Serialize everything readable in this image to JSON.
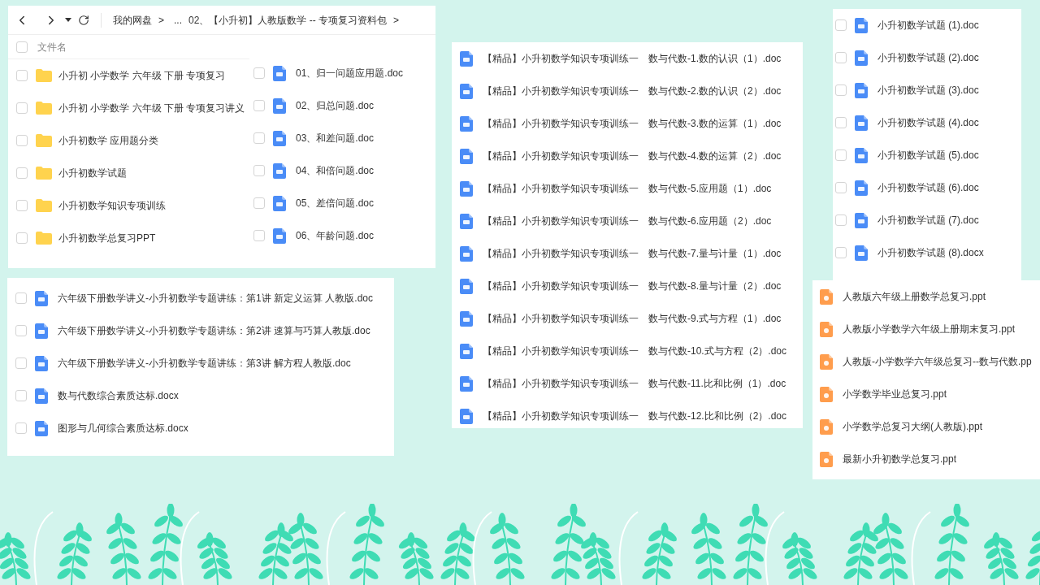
{
  "main_window": {
    "breadcrumb": [
      {
        "kind": "link",
        "text": "我的网盘"
      },
      {
        "kind": "separator",
        "text": ">"
      },
      {
        "kind": "link",
        "text": "..."
      },
      {
        "kind": "link",
        "text": "02、【小升初】人教版数学 -- 专项复习资料包"
      },
      {
        "kind": "separator",
        "text": ">"
      }
    ],
    "header": {
      "label": "文件名",
      "checked": false
    },
    "rows": [
      {
        "kind": "folder",
        "name": "小升初 小学数学 六年级 下册 专项复习",
        "checked": false
      },
      {
        "kind": "folder",
        "name": "小升初 小学数学 六年级 下册 专项复习讲义",
        "checked": false
      },
      {
        "kind": "folder",
        "name": "小升初数学 应用题分类",
        "checked": false
      },
      {
        "kind": "folder",
        "name": "小升初数学试题",
        "checked": false
      },
      {
        "kind": "folder",
        "name": "小升初数学知识专项训练",
        "checked": false
      },
      {
        "kind": "folder",
        "name": "小升初数学总复习PPT",
        "checked": false
      }
    ]
  },
  "panels": [
    {
      "kind": "checklist",
      "rows": [
        {
          "kind": "word",
          "name": "01、归一问题应用题.doc",
          "checked": false
        },
        {
          "kind": "word",
          "name": "02、归总问题.doc",
          "checked": false
        },
        {
          "kind": "word",
          "name": "03、和差问题.doc",
          "checked": false
        },
        {
          "kind": "word",
          "name": "04、和倍问题.doc",
          "checked": false
        },
        {
          "kind": "word",
          "name": "05、差倍问题.doc",
          "checked": false
        },
        {
          "kind": "word",
          "name": "06、年龄问题.doc",
          "checked": false
        }
      ]
    },
    {
      "kind": "checklist",
      "rows": [
        {
          "kind": "word",
          "name": "六年级下册数学讲义-小升初数学专题讲练：第1讲  新定义运算 人教版.doc",
          "checked": false
        },
        {
          "kind": "word",
          "name": "六年级下册数学讲义-小升初数学专题讲练：第2讲 速算与巧算人教版.doc",
          "checked": false
        },
        {
          "kind": "word",
          "name": "六年级下册数学讲义-小升初数学专题讲练：第3讲  解方程人教版.doc",
          "checked": false
        },
        {
          "kind": "word",
          "name": "数与代数综合素质达标.docx",
          "checked": false
        },
        {
          "kind": "word",
          "name": "图形与几何综合素质达标.docx",
          "checked": false
        }
      ]
    },
    {
      "kind": "list",
      "rows": [
        {
          "kind": "word",
          "name": "【精品】小升初数学知识专项训练一　数与代数-1.数的认识（1）.doc"
        },
        {
          "kind": "word",
          "name": "【精品】小升初数学知识专项训练一　数与代数-2.数的认识（2）.doc"
        },
        {
          "kind": "word",
          "name": "【精品】小升初数学知识专项训练一　数与代数-3.数的运算（1）.doc"
        },
        {
          "kind": "word",
          "name": "【精品】小升初数学知识专项训练一　数与代数-4.数的运算（2）.doc"
        },
        {
          "kind": "word",
          "name": "【精品】小升初数学知识专项训练一　数与代数-5.应用题（1）.doc"
        },
        {
          "kind": "word",
          "name": "【精品】小升初数学知识专项训练一　数与代数-6.应用题（2）.doc"
        },
        {
          "kind": "word",
          "name": "【精品】小升初数学知识专项训练一　数与代数-7.量与计量（1）.doc"
        },
        {
          "kind": "word",
          "name": "【精品】小升初数学知识专项训练一　数与代数-8.量与计量（2）.doc"
        },
        {
          "kind": "word",
          "name": "【精品】小升初数学知识专项训练一　数与代数-9.式与方程（1）.doc"
        },
        {
          "kind": "word",
          "name": "【精品】小升初数学知识专项训练一　数与代数-10.式与方程（2）.doc"
        },
        {
          "kind": "word",
          "name": "【精品】小升初数学知识专项训练一　数与代数-11.比和比例（1）.doc"
        },
        {
          "kind": "word",
          "name": "【精品】小升初数学知识专项训练一　数与代数-12.比和比例（2）.doc"
        }
      ]
    },
    {
      "kind": "checklist",
      "rows": [
        {
          "kind": "word",
          "name": "小升初数学试题 (1).doc",
          "checked": false
        },
        {
          "kind": "word",
          "name": "小升初数学试题 (2).doc",
          "checked": false
        },
        {
          "kind": "word",
          "name": "小升初数学试题 (3).doc",
          "checked": false
        },
        {
          "kind": "word",
          "name": "小升初数学试题 (4).doc",
          "checked": false
        },
        {
          "kind": "word",
          "name": "小升初数学试题 (5).doc",
          "checked": false
        },
        {
          "kind": "word",
          "name": "小升初数学试题 (6).doc",
          "checked": false
        },
        {
          "kind": "word",
          "name": "小升初数学试题 (7).doc",
          "checked": false
        },
        {
          "kind": "word",
          "name": "小升初数学试题 (8).docx",
          "checked": false
        }
      ]
    },
    {
      "kind": "list",
      "rows": [
        {
          "kind": "ppt",
          "name": "人教版六年级上册数学总复习.ppt"
        },
        {
          "kind": "ppt",
          "name": "人教版小学数学六年级上册期末复习.ppt"
        },
        {
          "kind": "ppt",
          "name": "人教版-小学数学六年级总复习--数与代数.pp"
        },
        {
          "kind": "ppt",
          "name": "小学数学毕业总复习.ppt"
        },
        {
          "kind": "ppt",
          "name": "小学数学总复习大纲(人教版).ppt"
        },
        {
          "kind": "ppt",
          "name": "最新小升初数学总复习.ppt"
        }
      ]
    }
  ]
}
